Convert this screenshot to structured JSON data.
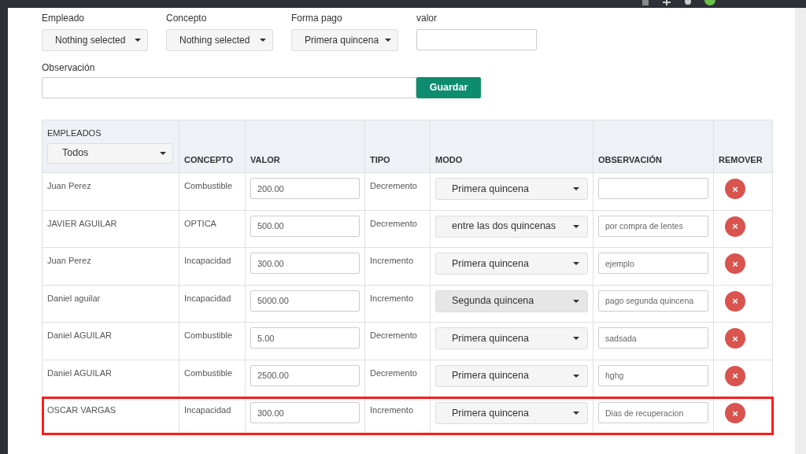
{
  "form": {
    "fields": [
      {
        "kind": "select",
        "label": "Empleado",
        "value": "Nothing selected"
      },
      {
        "kind": "select",
        "label": "Concepto",
        "value": "Nothing selected"
      },
      {
        "kind": "select",
        "label": "Forma pago",
        "value": "Primera quincena"
      },
      {
        "kind": "input",
        "label": "valor"
      }
    ],
    "observacion": {
      "label": "Observación"
    },
    "save_button": "Guardar"
  },
  "table": {
    "filter": {
      "label": "EMPLEADOS",
      "value": "Todos"
    },
    "columns": [
      "CONCEPTO",
      "VALOR",
      "TIPO",
      "MODO",
      "OBSERVACIÓN",
      "REMOVER"
    ],
    "rows": [
      {
        "empleado": "Juan Perez",
        "concepto": "Combustible",
        "valor": "200.00",
        "tipo": "Decremento",
        "modo": "Primera quincena",
        "modo_focused": false,
        "highlighted": false,
        "remove": "×"
      },
      {
        "empleado": "JAVIER AGUILAR",
        "concepto": "OPTICA",
        "valor": "500.00",
        "tipo": "Decremento",
        "modo": "entre las dos quincenas",
        "modo_focused": false,
        "observacion": "por compra de lentes",
        "highlighted": false,
        "remove": "×"
      },
      {
        "empleado": "Juan Perez",
        "concepto": "Incapacidad",
        "valor": "300.00",
        "tipo": "Incremento",
        "modo": "Primera quincena",
        "modo_focused": false,
        "observacion": "ejemplo",
        "highlighted": false,
        "remove": "×"
      },
      {
        "empleado": "Daniel aguilar",
        "concepto": "Incapacidad",
        "valor": "5000.00",
        "tipo": "Incremento",
        "modo": "Segunda quincena",
        "modo_focused": true,
        "observacion": "pago segunda quincena",
        "highlighted": false,
        "remove": "×"
      },
      {
        "empleado": "Daniel AGUILAR",
        "concepto": "Combustible",
        "valor": "5.00",
        "tipo": "Decremento",
        "modo": "Primera quincena",
        "modo_focused": false,
        "observacion": "sadsada",
        "highlighted": false,
        "remove": "×"
      },
      {
        "empleado": "Daniel AGUILAR",
        "concepto": "Combustible",
        "valor": "2500.00",
        "tipo": "Decremento",
        "modo": "Primera quincena",
        "modo_focused": false,
        "observacion": "hghg",
        "highlighted": false,
        "remove": "×"
      },
      {
        "empleado": "OSCAR VARGAS",
        "concepto": "Incapacidad",
        "valor": "300.00",
        "tipo": "Incremento",
        "modo": "Primera quincena",
        "modo_focused": false,
        "observacion": "Dias de recuperacion",
        "highlighted": true,
        "remove": "×"
      }
    ]
  }
}
